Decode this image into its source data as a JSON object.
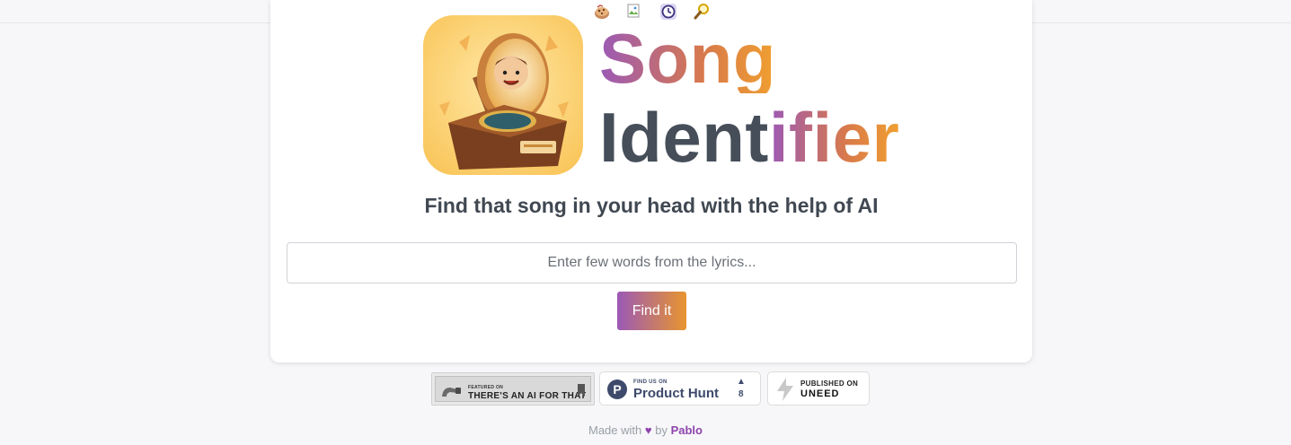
{
  "nav": {
    "icons": [
      "cookie-icon",
      "broken-image-icon",
      "clock-icon",
      "magnifier-icon"
    ]
  },
  "brand": {
    "title_line1": "Song",
    "title_line2_dark": "Ident",
    "title_line2_colored": "ifier"
  },
  "tagline": "Find that song in your head with the help of AI",
  "search": {
    "placeholder": "Enter few words from the lyrics...",
    "value": ""
  },
  "find_button_label": "Find it",
  "badges": {
    "aift": {
      "small": "FEATURED ON",
      "big": "THERE'S AN AI FOR THAT"
    },
    "product_hunt": {
      "small": "FIND US ON",
      "big": "Product Hunt",
      "arrow": "▲",
      "votes": "8"
    },
    "uneed": {
      "small": "PUBLISHED ON",
      "big": "UNEED"
    }
  },
  "footer": {
    "made_with": "Made with",
    "heart": "♥",
    "by": "by",
    "author": "Pablo"
  },
  "colors": {
    "gradient_start": "#9b59b6",
    "gradient_end": "#f0a030",
    "text_dark": "#454e59"
  }
}
